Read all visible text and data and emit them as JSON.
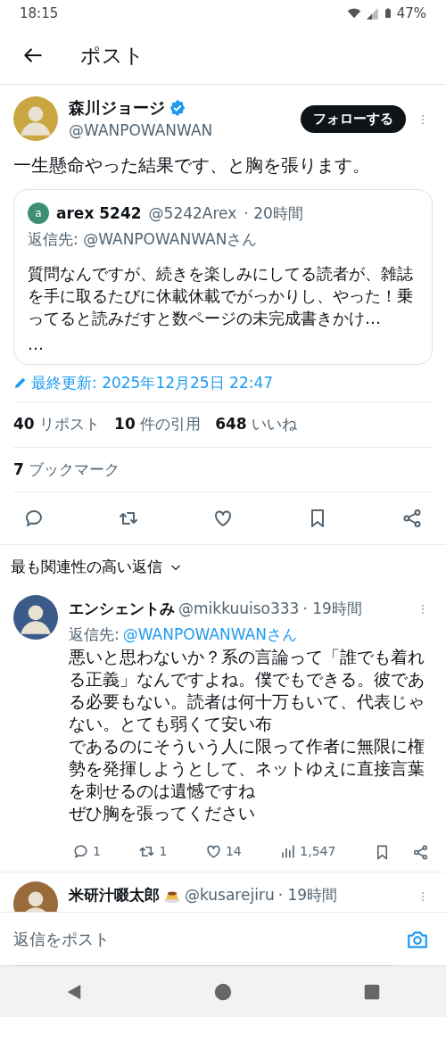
{
  "status_bar": {
    "time": "18:15",
    "battery": "47%"
  },
  "header": {
    "title": "ポスト"
  },
  "post": {
    "author": {
      "name": "森川ジョージ",
      "handle": "@WANPOWANWAN",
      "verified": true
    },
    "follow_button": "フォローする",
    "text": "一生懸命やった結果です、と胸を張ります。",
    "quote": {
      "avatar_letter": "a",
      "name": "arex 5242",
      "handle": "@5242Arex",
      "time": "· 20時間",
      "reply_to": "返信先: @WANPOWANWANさん",
      "text": "質問なんですが、続きを楽しみにしてる読者が、雑誌を手に取るたびに休載休載でがっかりし、やった！乗ってると読みだすと数ページの未完成書きかけ…",
      "ellipsis": "…"
    },
    "edited": "最終更新: 2025年12月25日 22:47",
    "stats": [
      {
        "count": "40",
        "label": "リポスト"
      },
      {
        "count": "10",
        "label": "件の引用"
      },
      {
        "count": "648",
        "label": "いいね"
      }
    ],
    "bookmarks": {
      "count": "7",
      "label": "ブックマーク"
    },
    "actions": [
      {
        "kind": "reply"
      },
      {
        "kind": "repost"
      },
      {
        "kind": "like"
      },
      {
        "kind": "bookmark"
      },
      {
        "kind": "share"
      }
    ]
  },
  "sort": {
    "label": "最も関連性の高い返信"
  },
  "replies": [
    {
      "name": "エンシェントみ",
      "handle": "@mikkuuiso333",
      "time": "· 19時間",
      "reply_to_label": "返信先:",
      "reply_to": "@WANPOWANWANさん",
      "paragraphs": [
        "悪いと思わないか？系の言論って「誰でも着れる正義」なんですよね。僕でもできる。彼である必要もない。読者は何十万もいて、代表じゃない。とても弱くて安い布",
        "であるのにそういう人に限って作者に無限に権勢を発揮しようとして、ネットゆえに直接言葉を刺せるのは遺憾ですね",
        "ぜひ胸を張ってください"
      ],
      "replies": "1",
      "reposts": "1",
      "likes": "14",
      "views": "1,547"
    },
    {
      "name": "米研汁啜太郎",
      "badge": true,
      "handle": "@kusarejiru",
      "time": "· 19時間"
    }
  ],
  "composer": {
    "placeholder": "返信をポスト"
  }
}
